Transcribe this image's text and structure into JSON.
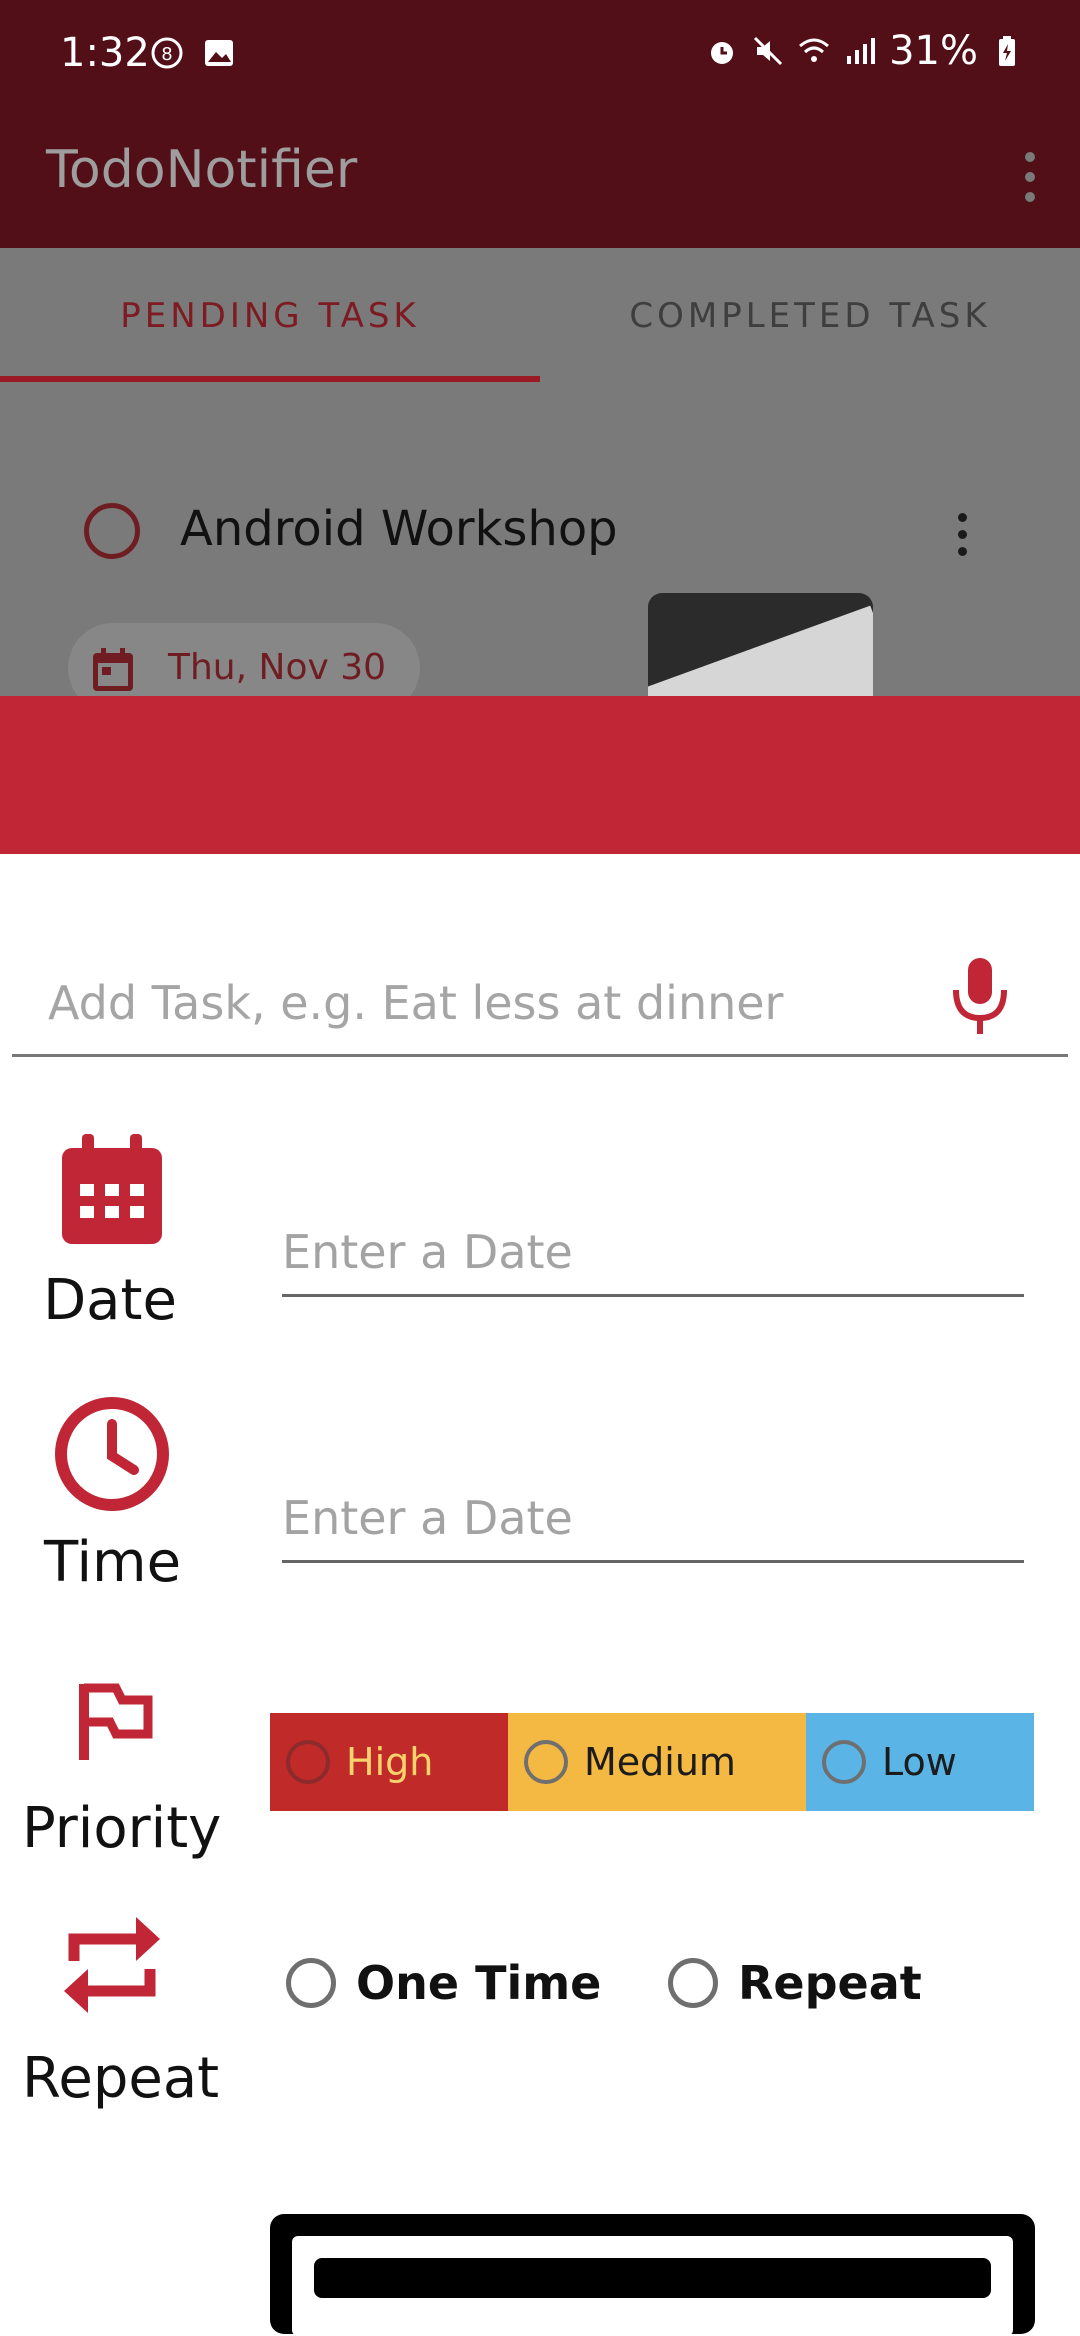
{
  "status_bar": {
    "time": "1:32",
    "battery": "31%",
    "icons": [
      "badge-icon",
      "image-icon",
      "alarm-icon",
      "mute-icon",
      "wifi-icon",
      "signal-icon",
      "battery-icon"
    ]
  },
  "app_bar": {
    "title": "TodoNotifier",
    "menu_icon": "more-vert-icon"
  },
  "tabs": [
    {
      "label": "PENDING TASK",
      "active": true
    },
    {
      "label": "COMPLETED TASK",
      "active": false
    }
  ],
  "task_list": {
    "items": [
      {
        "title": "Android Workshop",
        "date": "Thu, Nov  30"
      }
    ]
  },
  "add_task": {
    "placeholder": "Add Task, e.g. Eat less at dinner",
    "value": ""
  },
  "date_row": {
    "label": "Date",
    "placeholder": "Enter a Date"
  },
  "time_row": {
    "label": "Time",
    "placeholder": "Enter a Date"
  },
  "priority_row": {
    "label": "Priority",
    "options": [
      "High",
      "Medium",
      "Low"
    ]
  },
  "repeat_row": {
    "label": "Repeat",
    "options": [
      "One Time",
      "Repeat"
    ]
  },
  "colors": {
    "status_bar": "#520f18",
    "accent_red": "#c02636",
    "high": "#c02b2a",
    "medium": "#f4b942",
    "low": "#5ab4e5",
    "scrim": "#7a7a7a"
  }
}
